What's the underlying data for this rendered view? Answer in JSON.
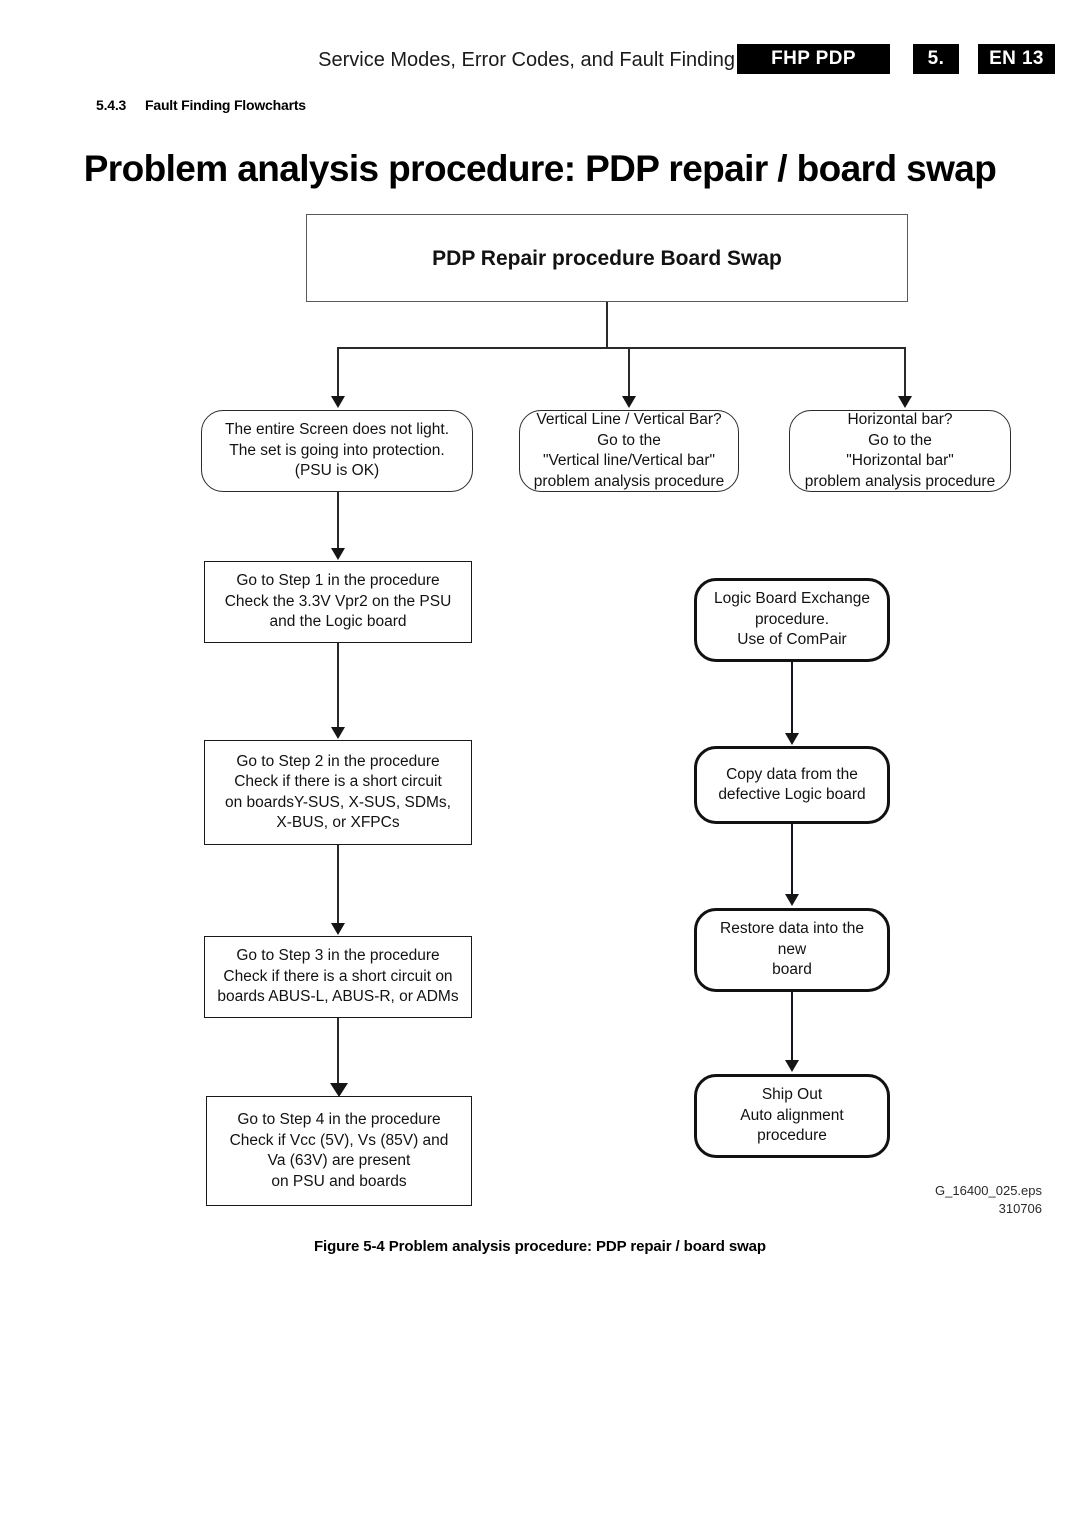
{
  "header": {
    "title": "Service Modes, Error Codes, and Fault Finding",
    "brand_badge": "FHP PDP",
    "chapter_badge": "5.",
    "page_badge": "EN 13"
  },
  "section": {
    "number": "5.4.3",
    "title": "Fault Finding Flowcharts"
  },
  "page_title": "Problem analysis procedure: PDP repair / board swap",
  "chart": {
    "root": "PDP Repair procedure Board Swap",
    "branches": [
      {
        "id": "screen-no-light",
        "lines": [
          "The entire Screen does not  light.",
          "The set is going into protection.",
          "(PSU is OK)"
        ]
      },
      {
        "id": "vertical-line-bar",
        "lines": [
          "Vertical Line / Vertical Bar?",
          "Go to the",
          "\"Vertical line/Vertical bar\"",
          "problem analysis procedure"
        ]
      },
      {
        "id": "horizontal-bar",
        "lines": [
          "Horizontal bar?",
          "Go to the",
          "\"Horizontal bar\"",
          "problem analysis procedure"
        ]
      }
    ],
    "steps": [
      {
        "id": "step-1",
        "lines": [
          "Go to Step 1 in the procedure",
          "Check the 3.3V Vpr2 on the PSU",
          "and the Logic board"
        ]
      },
      {
        "id": "step-2",
        "lines": [
          "Go to Step 2 in the procedure",
          "Check if there is a short circuit",
          "on boardsY-SUS, X-SUS, SDMs,",
          "X-BUS, or XFPCs"
        ]
      },
      {
        "id": "step-3",
        "lines": [
          "Go to Step 3 in the procedure",
          "Check if there is a short circuit on",
          "boards ABUS-L, ABUS-R, or ADMs"
        ]
      },
      {
        "id": "step-4",
        "lines": [
          "Go to Step 4 in the procedure",
          "Check if Vcc (5V), Vs (85V) and",
          "Va (63V) are present",
          "on PSU and boards"
        ]
      }
    ],
    "exchange_steps": [
      {
        "id": "logic-board-exchange",
        "lines": [
          "Logic Board Exchange",
          "procedure.",
          "Use of ComPair"
        ]
      },
      {
        "id": "copy-data",
        "lines": [
          "Copy data from the",
          "defective Logic board"
        ]
      },
      {
        "id": "restore-data",
        "lines": [
          "Restore data into the new",
          "board"
        ]
      },
      {
        "id": "ship-out",
        "lines": [
          "Ship Out",
          "Auto alignment procedure"
        ]
      }
    ]
  },
  "eps_id": {
    "file": "G_16400_025.eps",
    "number": "310706"
  },
  "figure_caption": "Figure 5-4 Problem analysis procedure: PDP repair / board swap",
  "colors": {
    "badge_background": "#000000",
    "badge_text": "#ffffff",
    "line": "#2a2a2a",
    "text": "#121212"
  }
}
